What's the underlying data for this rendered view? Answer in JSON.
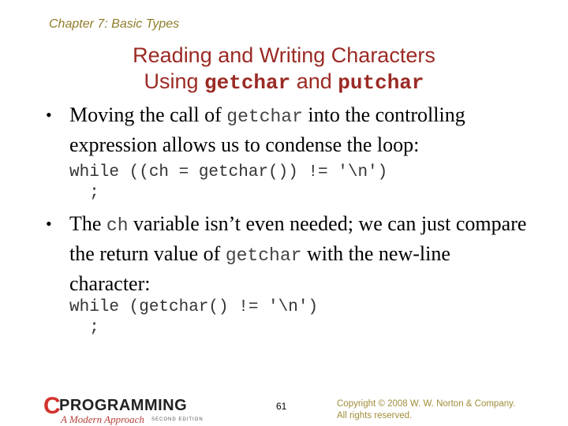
{
  "header": {
    "chapter": "Chapter 7: Basic Types"
  },
  "title": {
    "line1": "Reading and Writing Characters",
    "line2_prefix": "Using ",
    "line2_code1": "getchar",
    "line2_mid": " and ",
    "line2_code2": "putchar"
  },
  "bullets": [
    {
      "marker": "•",
      "parts": [
        "Moving the call of ",
        "getchar",
        " into the controlling expression allows us to condense the loop:"
      ],
      "code": [
        "while ((ch = getchar()) != '\\n')",
        "  ;"
      ]
    },
    {
      "marker": "•",
      "parts": [
        "The ",
        "ch",
        " variable isn’t even needed; we can just compare the return value of ",
        "getchar",
        " with the new-line character:"
      ],
      "code": [
        "while (getchar() != '\\n')",
        "  ;"
      ]
    }
  ],
  "footer": {
    "logo": {
      "c": "C",
      "title": "PROGRAMMING",
      "subtitle": "A Modern Approach",
      "edition": "SECOND EDITION"
    },
    "page_number": "61",
    "copyright_line1": "Copyright © 2008 W. W. Norton & Company.",
    "copyright_line2": "All rights reserved."
  },
  "colors": {
    "title": "#9b2a24",
    "chapter": "#8f7d2a",
    "copyright": "#a08d3a",
    "logo_c": "#d2322b"
  }
}
